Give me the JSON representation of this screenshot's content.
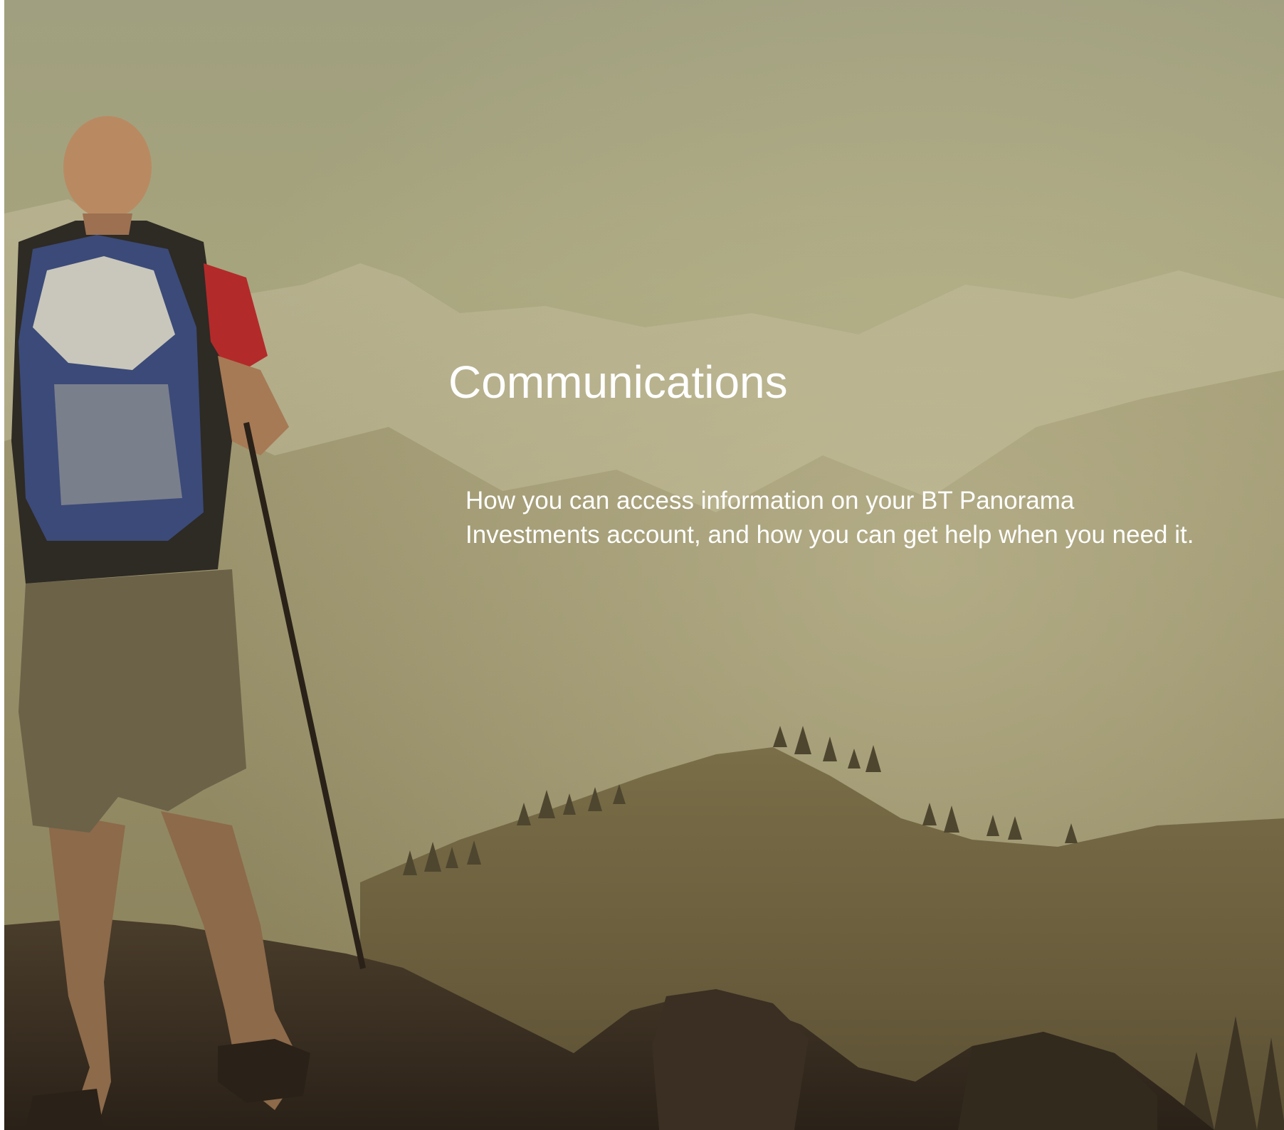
{
  "page": {
    "title": "Communications",
    "intro": "How you can access information on your BT Panorama Investments account, and how you can get help when you need it."
  },
  "hero_image": {
    "subject": "hiker-on-mountain-summit",
    "palette": {
      "sky": "#a09f7f",
      "haze": "#b4ae8a",
      "ridge": "#8b8561",
      "hill": "#6f6443",
      "rock": "#3a2f22",
      "shirt": "#b32a2a",
      "backpack": "#2a3660"
    }
  }
}
